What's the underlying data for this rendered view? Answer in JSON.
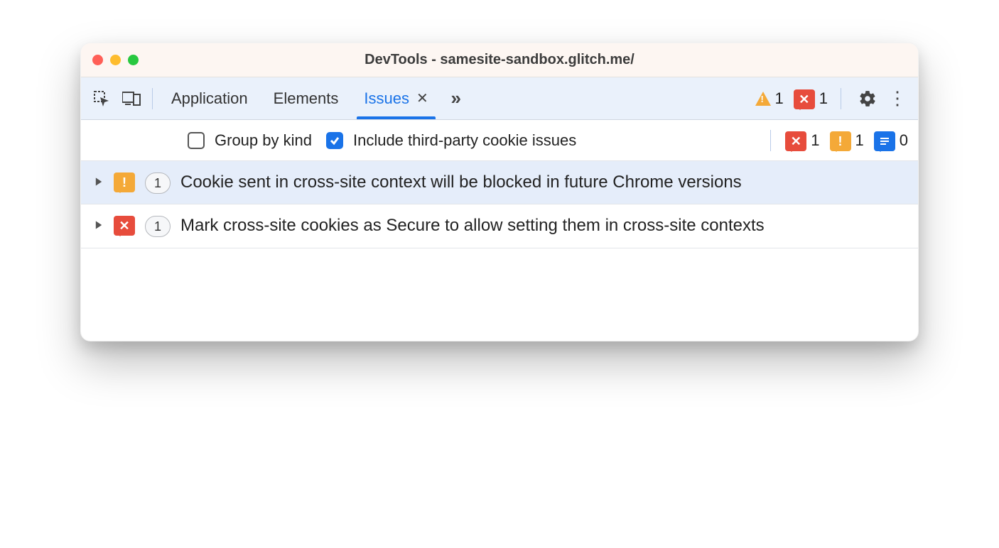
{
  "window": {
    "title": "DevTools - samesite-sandbox.glitch.me/"
  },
  "tabs": {
    "items": [
      "Application",
      "Elements",
      "Issues"
    ],
    "active_index": 2
  },
  "header_counts": {
    "warnings": "1",
    "errors": "1"
  },
  "toolbar": {
    "group_by_kind": {
      "label": "Group by kind",
      "checked": false
    },
    "include_third_party": {
      "label": "Include third-party cookie issues",
      "checked": true
    },
    "counts": {
      "errors": "1",
      "warnings": "1",
      "info": "0"
    }
  },
  "issues": [
    {
      "severity": "warning",
      "count": "1",
      "text": "Cookie sent in cross-site context will be blocked in future Chrome versions",
      "highlight": true
    },
    {
      "severity": "error",
      "count": "1",
      "text": "Mark cross-site cookies as Secure to allow setting them in cross-site contexts",
      "highlight": false
    }
  ]
}
